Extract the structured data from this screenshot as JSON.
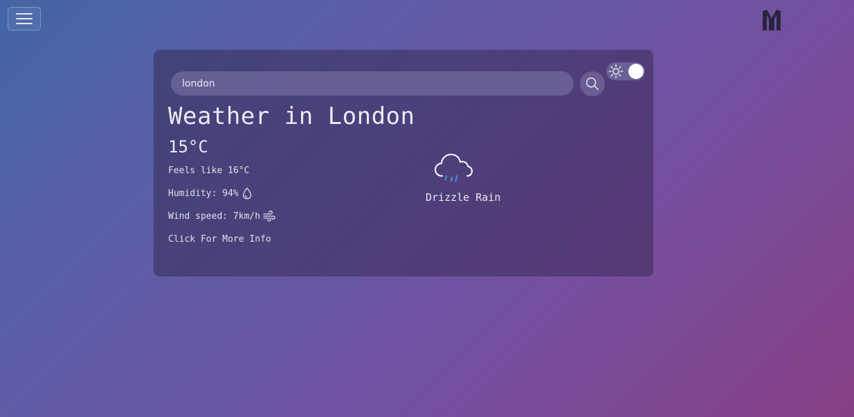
{
  "header": {
    "menu_icon": "hamburger-menu-icon",
    "logo_icon": "m-logo-icon"
  },
  "search": {
    "value": "london",
    "button_icon": "search-icon"
  },
  "theme": {
    "icon": "sun-icon",
    "state": "light"
  },
  "weather": {
    "title": "Weather in London",
    "temperature": "15°C",
    "feels_like": "Feels like 16°C",
    "humidity": "Humidity: 94%",
    "humidity_icon": "droplet-icon",
    "wind": "Wind speed: 7km/h",
    "wind_icon": "wind-icon",
    "more_info": "Click For More Info",
    "condition_icon": "cloud-drizzle-icon",
    "description": "Drizzle Rain"
  },
  "colors": {
    "background_start": "#4266a6",
    "background_end": "#873f83",
    "card": "#463c6e",
    "text": "#e8e6f0",
    "rain": "#4a90d9"
  }
}
